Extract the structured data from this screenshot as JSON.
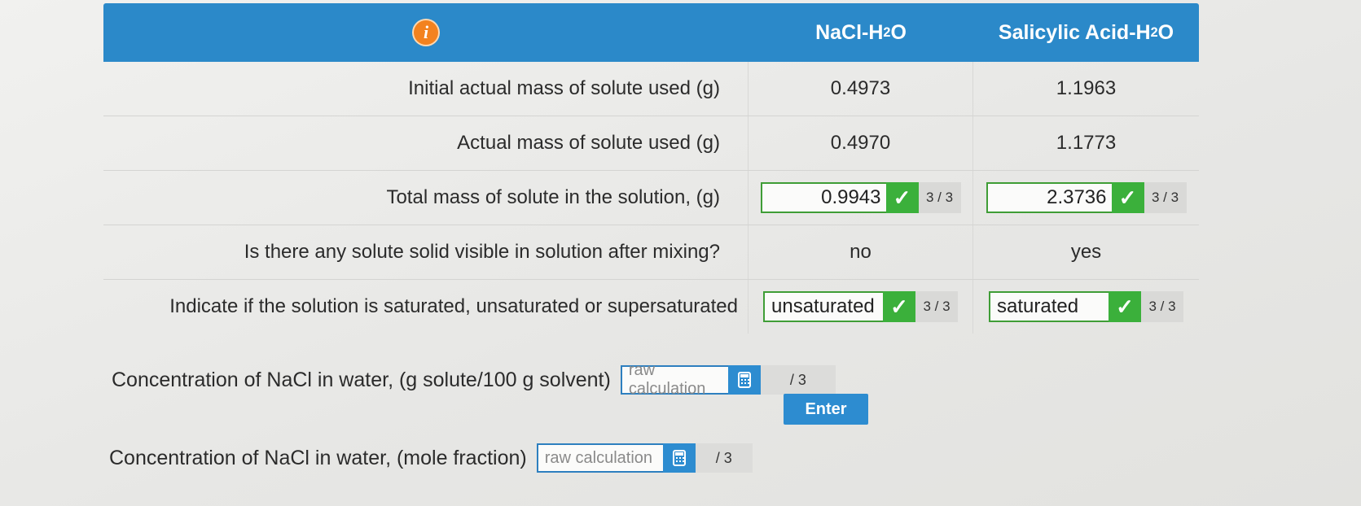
{
  "header": {
    "info_icon": "info-icon",
    "col1": "NaCl-H",
    "col1_sub": "2",
    "col1_tail": "O",
    "col2": "Salicylic Acid-H",
    "col2_sub": "2",
    "col2_tail": "O"
  },
  "rows": {
    "initial_mass": {
      "label": "Initial actual mass of solute used (g)",
      "nacl": "0.4973",
      "sal": "1.1963"
    },
    "actual_mass": {
      "label": "Actual mass of solute used (g)",
      "nacl": "0.4970",
      "sal": "1.1773"
    },
    "total_mass": {
      "label": "Total mass of solute in the solution, (g)",
      "nacl": "0.9943",
      "nacl_score": "3 / 3",
      "sal": "2.3736",
      "sal_score": "3 / 3"
    },
    "visible": {
      "label": "Is there any solute solid visible in solution after mixing?",
      "nacl": "no",
      "sal": "yes"
    },
    "saturation": {
      "label": "Indicate if the solution is saturated, unsaturated or supersaturated",
      "nacl": "unsaturated",
      "nacl_score": "3 / 3",
      "sal": "saturated",
      "sal_score": "3 / 3"
    }
  },
  "conc_g": {
    "label": "Concentration of NaCl in water, (g solute/100 g solvent)",
    "placeholder": "raw calculation",
    "score": "/ 3",
    "enter": "Enter"
  },
  "conc_mole": {
    "label": "Concentration of NaCl in water, (mole fraction)",
    "placeholder": "raw calculation",
    "score": "/ 3"
  },
  "colors": {
    "header_blue": "#2b89c9",
    "correct_green": "#3bb03b",
    "info_orange": "#f3821f",
    "button_blue": "#2d8cd0"
  }
}
